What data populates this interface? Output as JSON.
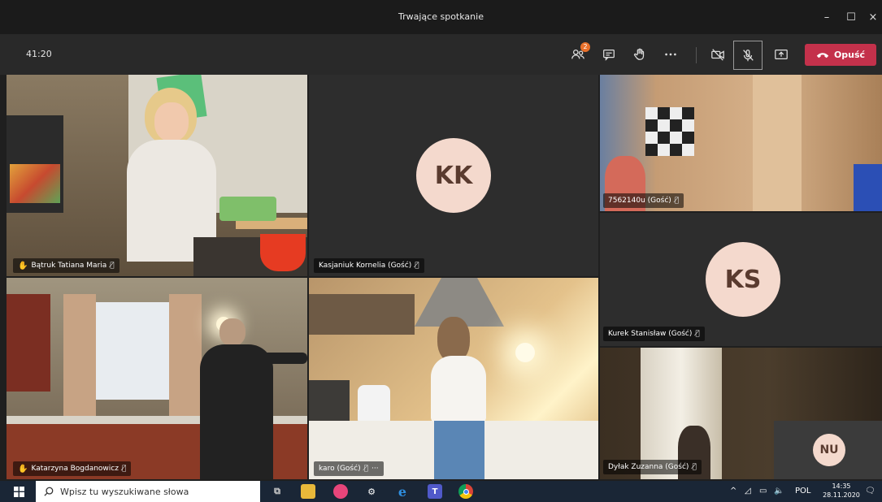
{
  "window": {
    "title": "Trwające spotkanie",
    "controls": {
      "minimize": "–",
      "maximize": "☐",
      "close": "×"
    }
  },
  "toolbar": {
    "timer": "41:20",
    "participants_badge": "2",
    "leave_label": "Opuść"
  },
  "tiles": [
    {
      "id": "tile-1",
      "name": "Bątruk Tatiana Maria",
      "hand_raised": true,
      "muted": true,
      "type": "video"
    },
    {
      "id": "tile-2",
      "name": "Kasjaniuk Kornelia (Gość)",
      "hand_raised": false,
      "muted": true,
      "type": "avatar",
      "initials": "KK"
    },
    {
      "id": "tile-3",
      "name": "7562140u (Gość)",
      "hand_raised": false,
      "muted": true,
      "type": "video"
    },
    {
      "id": "tile-4",
      "name": "Kurek Stanisław (Gość)",
      "hand_raised": false,
      "muted": true,
      "type": "avatar",
      "initials": "KS"
    },
    {
      "id": "tile-5",
      "name": "Katarzyna Bogdanowicz",
      "hand_raised": true,
      "muted": true,
      "type": "video"
    },
    {
      "id": "tile-6",
      "name": "karo (Gość)",
      "hand_raised": false,
      "muted": true,
      "more": "···",
      "type": "video"
    },
    {
      "id": "tile-7",
      "name": "Dyłak Zuzanna (Gość)",
      "hand_raised": false,
      "muted": true,
      "type": "video"
    },
    {
      "id": "tile-self",
      "initials": "NU",
      "type": "avatar"
    }
  ],
  "taskbar": {
    "search_placeholder": "Wpisz tu wyszukiwane słowa",
    "language": "POL",
    "time": "14:35",
    "date": "28.11.2020"
  },
  "colors": {
    "leave_red": "#c4314b",
    "avatar_bg": "#f4d9cd",
    "avatar_text": "#5a3b2f",
    "hand_yellow": "#f2c31c",
    "badge_orange": "#e8702a"
  }
}
